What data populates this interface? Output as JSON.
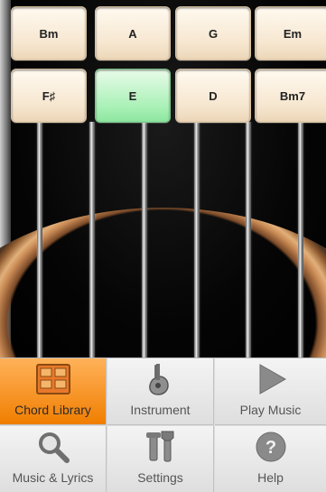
{
  "chords": {
    "row1": [
      "Bm",
      "A",
      "G",
      "Em"
    ],
    "row2": [
      "F♯",
      "E",
      "D",
      "Bm7"
    ],
    "selected": "E"
  },
  "menu": {
    "items": [
      {
        "label": "Chord Library",
        "icon": "chord-grid-icon",
        "active": true
      },
      {
        "label": "Instrument",
        "icon": "guitar-icon",
        "active": false
      },
      {
        "label": "Play Music",
        "icon": "play-icon",
        "active": false
      },
      {
        "label": "Music & Lyrics",
        "icon": "search-icon",
        "active": false
      },
      {
        "label": "Settings",
        "icon": "tools-icon",
        "active": false
      },
      {
        "label": "Help",
        "icon": "help-icon",
        "active": false
      }
    ]
  },
  "colors": {
    "accent": "#f07e00",
    "selected_chord": "#a6f0b4",
    "chord_button": "#f6e6cf"
  }
}
